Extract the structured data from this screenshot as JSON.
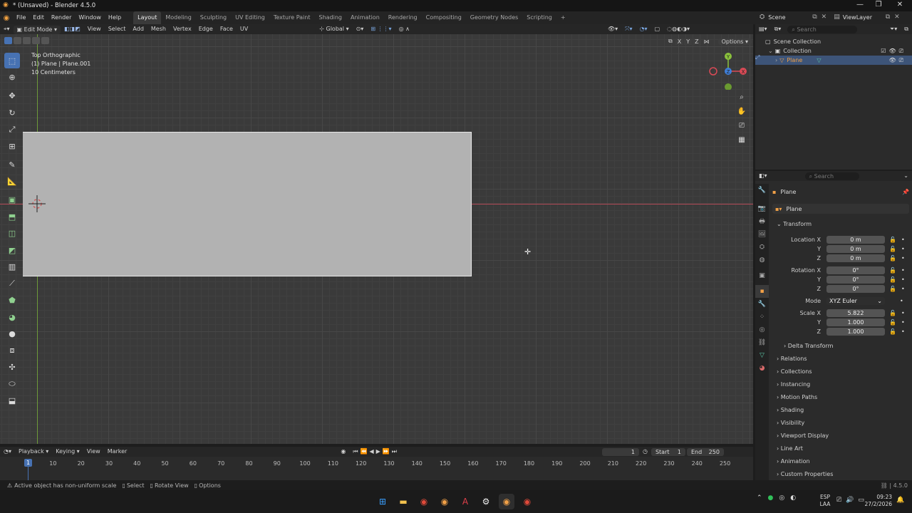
{
  "window": {
    "title": "* (Unsaved) - Blender 4.5.0",
    "controls": [
      "—",
      "❐",
      "✕"
    ]
  },
  "menus": [
    "File",
    "Edit",
    "Render",
    "Window",
    "Help"
  ],
  "workspaces": [
    "Layout",
    "Modeling",
    "Sculpting",
    "UV Editing",
    "Texture Paint",
    "Shading",
    "Animation",
    "Rendering",
    "Compositing",
    "Geometry Nodes",
    "Scripting"
  ],
  "add_workspace": "+",
  "scene": {
    "name": "Scene",
    "view_layer": "ViewLayer"
  },
  "viewport_header": {
    "mode": "Edit Mode",
    "menus": [
      "View",
      "Select",
      "Add",
      "Mesh",
      "Vertex",
      "Edge",
      "Face",
      "UV"
    ],
    "orientation": "Global",
    "options": "Options",
    "axes": [
      "X",
      "Y",
      "Z"
    ]
  },
  "viewport_info": {
    "view": "Top Orthographic",
    "object": "(1) Plane | Plane.001",
    "scale": "10 Centimeters"
  },
  "gizmo": {
    "y": "Y",
    "z": "Z",
    "x": "X"
  },
  "outliner": {
    "search_placeholder": "Search",
    "items": [
      {
        "label": "Scene Collection"
      },
      {
        "label": "Collection"
      },
      {
        "label": "Plane"
      }
    ]
  },
  "properties": {
    "search_placeholder": "Search",
    "object_name": "Plane",
    "data_name": "Plane",
    "transform_title": "Transform",
    "location": {
      "label_x": "Location X",
      "label_y": "Y",
      "label_z": "Z",
      "x": "0 m",
      "y": "0 m",
      "z": "0 m"
    },
    "rotation": {
      "label_x": "Rotation X",
      "label_y": "Y",
      "label_z": "Z",
      "x": "0°",
      "y": "0°",
      "z": "0°"
    },
    "mode": {
      "label": "Mode",
      "value": "XYZ Euler"
    },
    "scale": {
      "label_x": "Scale X",
      "label_y": "Y",
      "label_z": "Z",
      "x": "5.822",
      "y": "1.000",
      "z": "1.000"
    },
    "delta": "Delta Transform",
    "sections": [
      "Relations",
      "Collections",
      "Instancing",
      "Motion Paths",
      "Shading",
      "Visibility",
      "Viewport Display",
      "Line Art",
      "Animation",
      "Custom Properties"
    ]
  },
  "timeline": {
    "menus": [
      "Playback",
      "Keying",
      "View",
      "Marker"
    ],
    "current_frame": "1",
    "start_label": "Start",
    "start": "1",
    "end_label": "End",
    "end": "250",
    "ticks": [
      "10",
      "20",
      "30",
      "40",
      "50",
      "60",
      "70",
      "80",
      "90",
      "100",
      "110",
      "120",
      "130",
      "140",
      "150",
      "160",
      "170",
      "180",
      "190",
      "200",
      "210",
      "220",
      "230",
      "240",
      "250"
    ],
    "playhead": "1"
  },
  "status": {
    "message": "Active object has non-uniform scale",
    "select": "Select",
    "rotate": "Rotate View",
    "options": "Options",
    "version": "4.5.0"
  },
  "taskbar": {
    "lang1": "ESP",
    "lang2": "LAA",
    "time": "09:23",
    "date": "27/2/2026"
  }
}
